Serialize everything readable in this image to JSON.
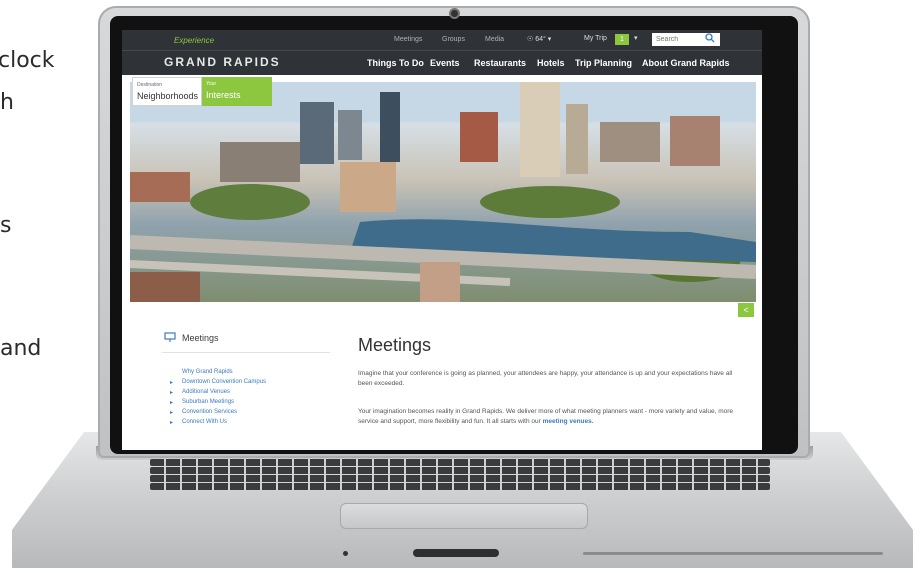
{
  "background_text": [
    "clock",
    "h",
    "s",
    "and"
  ],
  "site": {
    "logo_top": "Experience",
    "logo": "GRAND RAPIDS",
    "utility": [
      "Meetings",
      "Groups",
      "Media"
    ],
    "weather": "☉ 64° ▾",
    "mytrip": {
      "label": "My Trip",
      "count": "1",
      "chev": "▾"
    },
    "search_placeholder": "Search",
    "nav": [
      "Things To Do",
      "Events",
      "Restaurants",
      "Hotels",
      "Trip Planning",
      "About Grand Rapids"
    ]
  },
  "tabs": [
    {
      "sub": "Destination",
      "main": "Neighborhoods"
    },
    {
      "sub": "Your",
      "main": "Interests"
    }
  ],
  "sidebar": {
    "title": "Meetings",
    "items": [
      "Why Grand Rapids",
      "Downtown Convention Campus",
      "Additional Venues",
      "Suburban Meetings",
      "Convention Services",
      "Connect With Us"
    ]
  },
  "content": {
    "heading": "Meetings",
    "para1": "Imagine that your conference is going as planned, your attendees are happy, your attendance is up and your expectations have all been exceeded.",
    "para2": "Your imagination becomes reality in Grand Rapids. We deliver more of what meeting planners want - more variety and value, more service and support, more flexibility and fun. It all starts with our",
    "para2_link": "meeting venues."
  },
  "colors": {
    "accent": "#8dc63f",
    "header": "#2f3236",
    "link": "#3a7bbf"
  }
}
